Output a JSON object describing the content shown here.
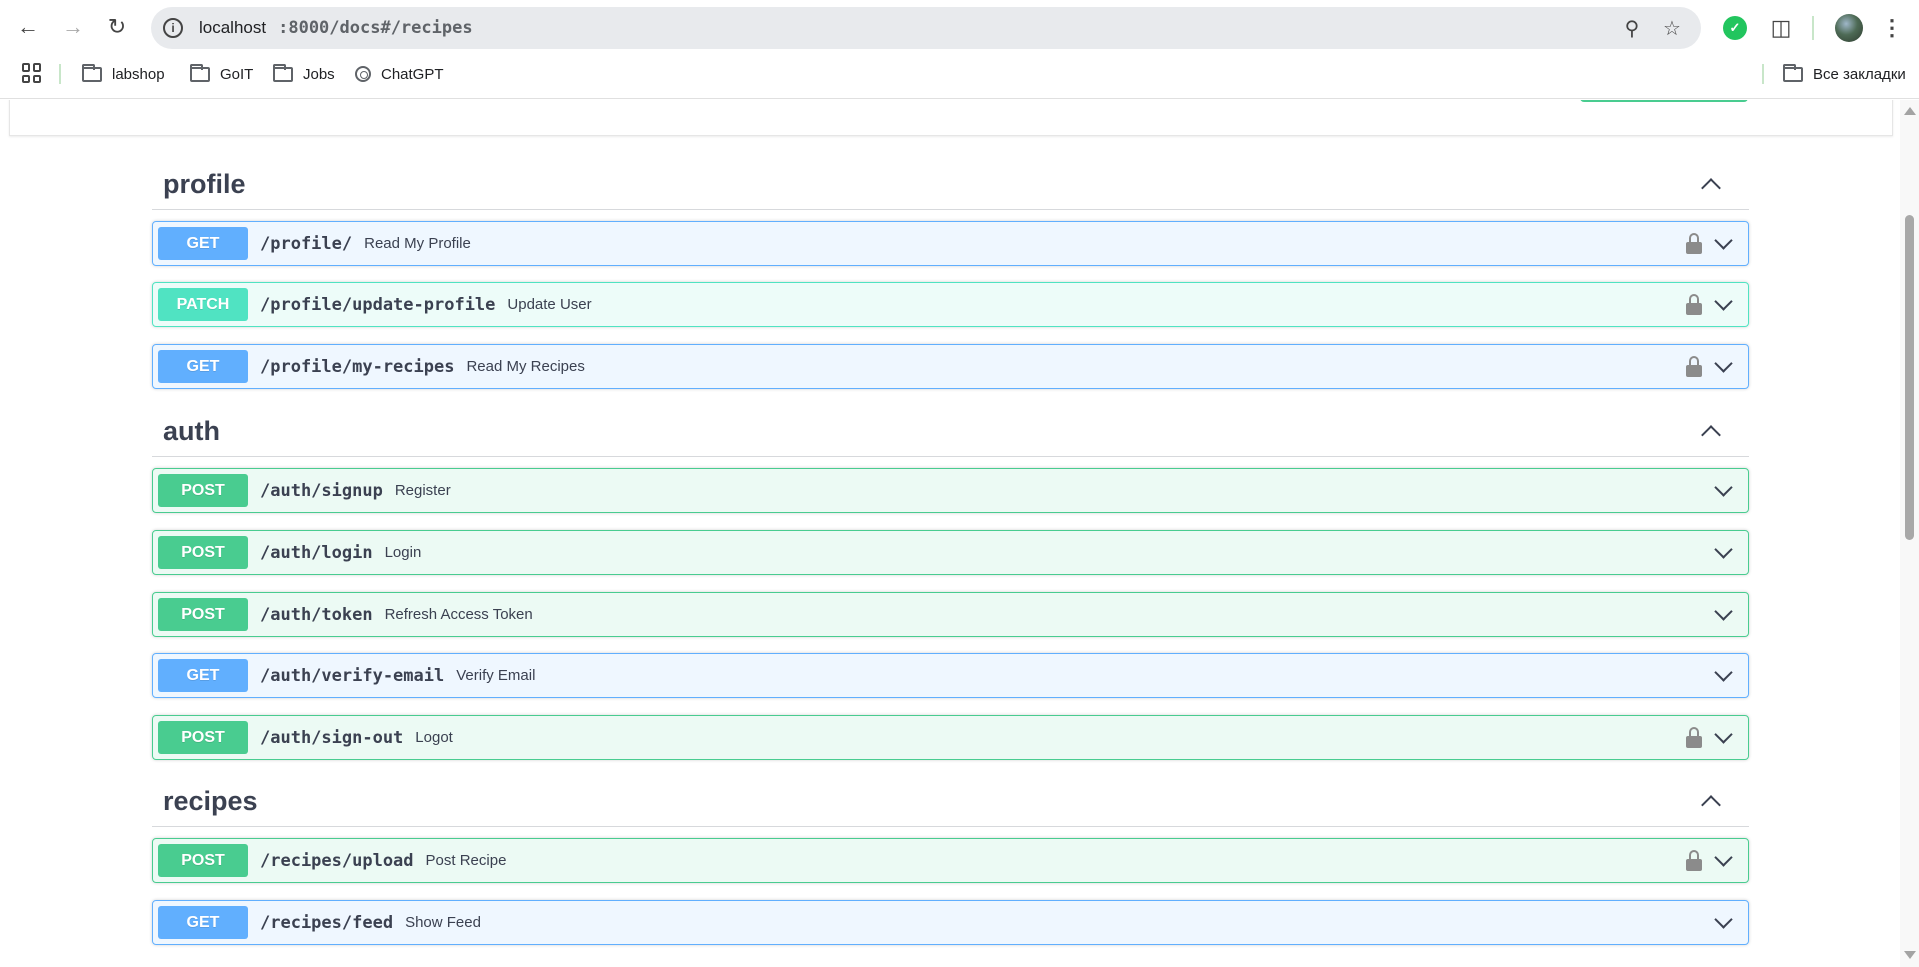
{
  "browser": {
    "url_host": "localhost",
    "url_path": ":8000/docs#/recipes",
    "bookmarks": [
      {
        "label": "labshop",
        "type": "folder"
      },
      {
        "label": "GoIT",
        "type": "folder"
      },
      {
        "label": "Jobs",
        "type": "folder"
      },
      {
        "label": "ChatGPT",
        "type": "site"
      }
    ],
    "all_bookmarks_label": "Все закладки"
  },
  "tags": [
    {
      "name": "profile",
      "operations": [
        {
          "method": "GET",
          "path": "/profile/",
          "summary": "Read My Profile",
          "locked": true
        },
        {
          "method": "PATCH",
          "path": "/profile/update-profile",
          "summary": "Update User",
          "locked": true
        },
        {
          "method": "GET",
          "path": "/profile/my-recipes",
          "summary": "Read My Recipes",
          "locked": true
        }
      ]
    },
    {
      "name": "auth",
      "operations": [
        {
          "method": "POST",
          "path": "/auth/signup",
          "summary": "Register",
          "locked": false
        },
        {
          "method": "POST",
          "path": "/auth/login",
          "summary": "Login",
          "locked": false
        },
        {
          "method": "POST",
          "path": "/auth/token",
          "summary": "Refresh Access Token",
          "locked": false
        },
        {
          "method": "GET",
          "path": "/auth/verify-email",
          "summary": "Verify Email",
          "locked": false
        },
        {
          "method": "POST",
          "path": "/auth/sign-out",
          "summary": "Logot",
          "locked": true
        }
      ]
    },
    {
      "name": "recipes",
      "operations": [
        {
          "method": "POST",
          "path": "/recipes/upload",
          "summary": "Post Recipe",
          "locked": true
        },
        {
          "method": "GET",
          "path": "/recipes/feed",
          "summary": "Show Feed",
          "locked": false
        }
      ]
    }
  ],
  "colors": {
    "get": "#61affe",
    "post": "#49cc90",
    "patch": "#50e3c2"
  }
}
